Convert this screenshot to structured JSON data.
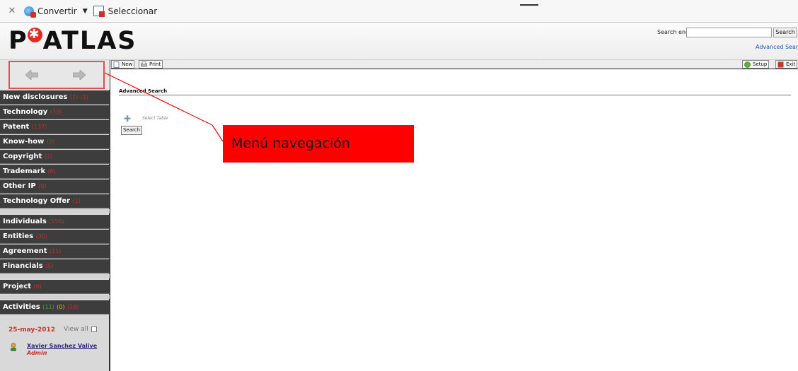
{
  "plugin_bar": {
    "convert_label": "Convertir",
    "select_label": "Seleccionar"
  },
  "header": {
    "logo_left": "P",
    "logo_right": "ATLAS",
    "search_label": "Search engine",
    "search_value": "",
    "search_button": "Search",
    "advanced_link": "Advanced Searc"
  },
  "toolbar": {
    "new_label": "New",
    "print_label": "Print",
    "setup_label": "Setup",
    "exit_label": "Exit"
  },
  "sidebar": {
    "menu": [
      {
        "label": "New disclosures",
        "counts": [
          "(1)",
          "(1)"
        ]
      },
      {
        "label": "Technology",
        "counts": [
          "(73)"
        ]
      },
      {
        "label": "Patent",
        "counts": [
          "(137)"
        ]
      },
      {
        "label": "Know-how",
        "counts": [
          "(2)"
        ]
      },
      {
        "label": "Copyright",
        "counts": [
          "(2)"
        ]
      },
      {
        "label": "Trademark",
        "counts": [
          "(6)"
        ]
      },
      {
        "label": "Other IP",
        "counts": [
          "(0)"
        ]
      },
      {
        "label": "Technology Offer",
        "counts": [
          "(1)"
        ]
      },
      {
        "label": "Individuals",
        "counts": [
          "(156)"
        ]
      },
      {
        "label": "Entities",
        "counts": [
          "(30)"
        ]
      },
      {
        "label": "Agreement",
        "counts": [
          "(11)"
        ]
      },
      {
        "label": "Financials",
        "counts": [
          "(5)"
        ]
      },
      {
        "label": "Project",
        "counts": [
          "(0)"
        ]
      },
      {
        "label": "Activities",
        "counts": [
          "(11)",
          "(0)",
          "(18)"
        ]
      }
    ],
    "date": "25-may-2012",
    "view_all": "View all",
    "user_name": "Xavier Sanchez Valive",
    "user_role": "Admin"
  },
  "main": {
    "section_title": "Advanced Search",
    "select_table": "Select Table",
    "search_button": "Search"
  },
  "annotation": {
    "label": "Menú navegación"
  },
  "colors": {
    "sidebar_item": "#3d3d3d",
    "count_red": "#c03030",
    "annotation_red": "#ff0000",
    "logo_red": "#e32a1f"
  }
}
